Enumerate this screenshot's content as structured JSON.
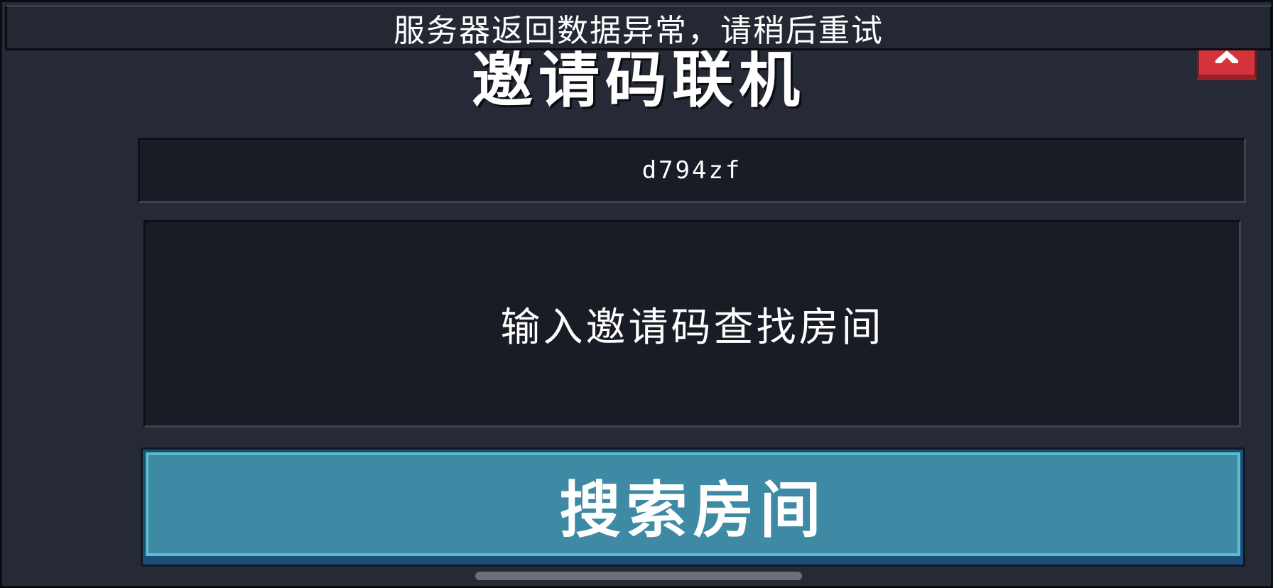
{
  "toast": {
    "message": "服务器返回数据异常，请稍后重试"
  },
  "dialog": {
    "title": "邀请码联机",
    "close_icon": "chevron-up-icon",
    "invite_code": "d794zf",
    "info_text": "输入邀请码查找房间",
    "search_button_label": "搜索房间"
  },
  "colors": {
    "background": "#262a36",
    "panel": "#1a1c25",
    "button": "#3e8aa4",
    "button_highlight": "#5bbdc6",
    "button_shadow": "#1c4c7a",
    "close_button": "#d6343c",
    "text": "#ffffff"
  }
}
